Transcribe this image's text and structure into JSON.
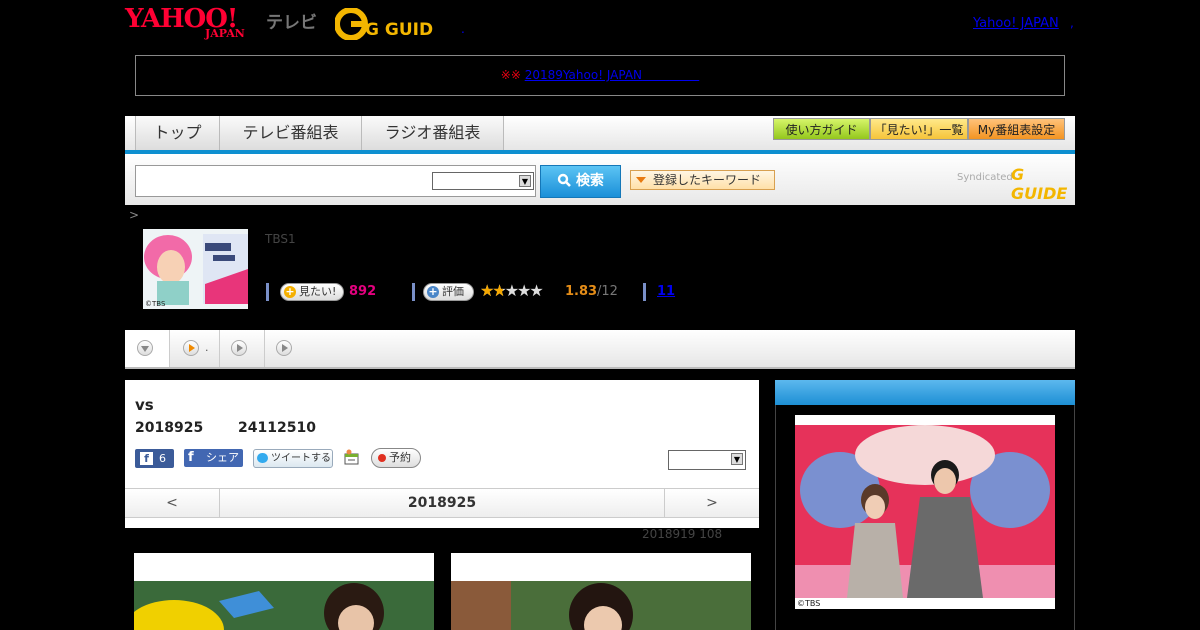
{
  "header": {
    "yahoo_logo": "YAHOO!",
    "japan_logo": "JAPAN",
    "tv_label": "テレビ",
    "gguide_logo": "G GUIDE",
    "yahoo_link": "Yahoo! JAPAN",
    "sep_dot": ",",
    "sep_dot2": "."
  },
  "notice": {
    "marks": "※※",
    "link": "20189Yahoo! JAPAN"
  },
  "nav": {
    "tabs": [
      "トップ",
      "テレビ番組表",
      "ラジオ番組表"
    ],
    "buttons": [
      "使い方ガイド",
      "「見たい!」一覧",
      "My番組表設定"
    ]
  },
  "search": {
    "button": "検索",
    "keyword_button": "登録したキーワード",
    "syndicated": "Syndicated",
    "syndicated_logo": "G GUIDE"
  },
  "breadcrumb": ">",
  "program": {
    "channel": "TBS1",
    "thumb_credit": "©TBS",
    "want_button": "見たい!",
    "want_count": "892",
    "rate_button": "評価",
    "stars": "★★★★★",
    "rating": 1.83,
    "rating_text": "1.83",
    "rating_count": "/12",
    "link_count": "11"
  },
  "subtabs": {
    "dot": "."
  },
  "main": {
    "title": "vs",
    "date": "2018925",
    "time": "24112510",
    "fb_like_count": "6",
    "fb_share": "シェア",
    "tweet": "ツイートする",
    "reserve": "予約",
    "date_nav": {
      "prev": "<",
      "current": "2018925",
      "next": ">"
    },
    "prev_airing": "2018919  108"
  },
  "side": {
    "img_credit": "©TBS"
  },
  "colors": {
    "accent_blue": "#0d8fd0",
    "yahoo_red": "#ff0033",
    "count_pink": "#e4007f",
    "rating_orange": "#e58d18"
  }
}
